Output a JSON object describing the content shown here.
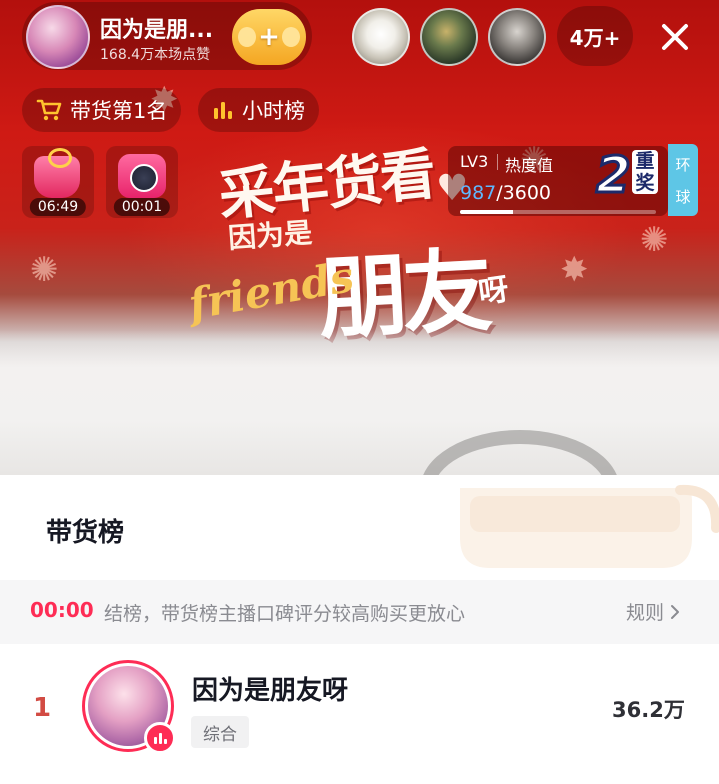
{
  "live": {
    "host_name": "因为是朋...",
    "likes": "168.4万本场点赞",
    "viewer_count": "4万+"
  },
  "chips": {
    "sales_rank": "带货第1名",
    "hourly_rank": "小时榜"
  },
  "gifts": [
    {
      "time": "06:49"
    },
    {
      "time": "00:01"
    }
  ],
  "heat": {
    "level": "LV3",
    "label": "热度值",
    "current": "987",
    "total": "/3600",
    "progress": 0.27,
    "badge_number": "2",
    "badge_line1": "重",
    "badge_line2": "奖",
    "side_tag_line1": "环",
    "side_tag_line2": "球"
  },
  "banner": {
    "line1": "采年货看",
    "small": "因为是",
    "friends": "friends",
    "big": "朋友",
    "ya": "呀"
  },
  "sheet": {
    "title": "带货榜",
    "notice_time": "00:00",
    "notice_text": "结榜，带货榜主播口碑评分较高购买更放心",
    "rule_label": "规则"
  },
  "ranking": [
    {
      "rank": "1",
      "name": "因为是朋友呀",
      "tag": "综合",
      "score": "36.2万"
    }
  ],
  "colors": {
    "accent": "#fe2c55",
    "rank_red": "#d24b43",
    "follow_gold": "#f4a622",
    "heat_blue": "#5fb8ff",
    "side_tag": "#5ec6e6"
  },
  "icons": {
    "follow": "plus-icon",
    "sales_rank": "cart-icon",
    "hourly_rank": "bar-chart-icon",
    "close": "close-icon",
    "rule": "chevron-right-icon",
    "live": "live-bars-icon"
  }
}
